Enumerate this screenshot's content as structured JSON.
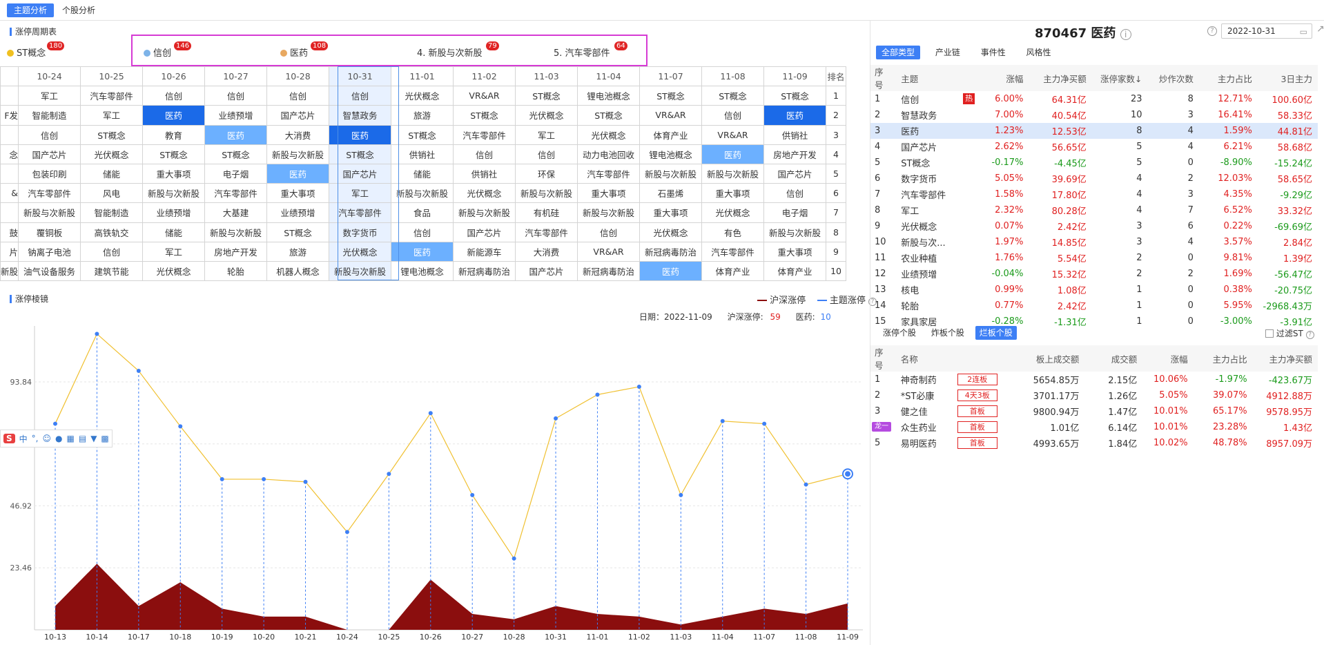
{
  "top_tabs": [
    {
      "label": "主题分析"
    },
    {
      "label": "个股分析"
    }
  ],
  "cycle_title": "涨停周期表",
  "themes": [
    {
      "label": "ST概念",
      "badge": "180",
      "color": "#f0c020"
    },
    {
      "label": "信创",
      "badge": "146",
      "color": "#7db3e8"
    },
    {
      "label": "医药",
      "badge": "108",
      "color": "#e8a860"
    },
    {
      "label": "4. 新股与次新股",
      "badge": "79",
      "color": ""
    },
    {
      "label": "5. 汽车零部件",
      "badge": "64",
      "color": ""
    }
  ],
  "grid": {
    "dates": [
      "",
      "10-24",
      "10-25",
      "10-26",
      "10-27",
      "10-28",
      "10-31",
      "11-01",
      "11-02",
      "11-03",
      "11-04",
      "11-07",
      "11-08",
      "11-09",
      "排名"
    ],
    "rows": [
      {
        "cells": [
          "",
          "军工",
          "汽车零部件",
          "信创",
          "信创",
          "信创",
          "信创",
          "光伏概念",
          "VR&AR",
          "ST概念",
          "锂电池概念",
          "ST概念",
          "ST概念",
          "ST概念"
        ],
        "rank": "1"
      },
      {
        "cells": [
          "F发",
          "智能制造",
          "军工",
          "医药",
          "业绩预增",
          "国产芯片",
          "智慧政务",
          "旅游",
          "ST概念",
          "光伏概念",
          "ST概念",
          "VR&AR",
          "信创",
          "医药"
        ],
        "rank": "2"
      },
      {
        "cells": [
          "",
          "信创",
          "ST概念",
          "教育",
          "医药",
          "大消费",
          "医药",
          "ST概念",
          "汽车零部件",
          "军工",
          "光伏概念",
          "体育产业",
          "VR&AR",
          "供销社"
        ],
        "rank": "3"
      },
      {
        "cells": [
          "念",
          "国产芯片",
          "光伏概念",
          "ST概念",
          "ST概念",
          "新股与次新股",
          "ST概念",
          "供销社",
          "信创",
          "信创",
          "动力电池回收",
          "锂电池概念",
          "医药",
          "房地产开发"
        ],
        "rank": "4"
      },
      {
        "cells": [
          "",
          "包装印刷",
          "储能",
          "重大事项",
          "电子烟",
          "医药",
          "国产芯片",
          "储能",
          "供销社",
          "环保",
          "汽车零部件",
          "新股与次新股",
          "新股与次新股",
          "国产芯片"
        ],
        "rank": "5"
      },
      {
        "cells": [
          "&",
          "汽车零部件",
          "风电",
          "新股与次新股",
          "汽车零部件",
          "重大事项",
          "军工",
          "新股与次新股",
          "光伏概念",
          "新股与次新股",
          "重大事项",
          "石墨烯",
          "重大事项",
          "信创"
        ],
        "rank": "6"
      },
      {
        "cells": [
          "",
          "新股与次新股",
          "智能制造",
          "业绩预增",
          "大基建",
          "业绩预增",
          "汽车零部件",
          "食品",
          "新股与次新股",
          "有机硅",
          "新股与次新股",
          "重大事项",
          "光伏概念",
          "电子烟"
        ],
        "rank": "7"
      },
      {
        "cells": [
          "鼓",
          "覆铜板",
          "高铁轨交",
          "储能",
          "新股与次新股",
          "ST概念",
          "数字货币",
          "信创",
          "国产芯片",
          "汽车零部件",
          "信创",
          "光伏概念",
          "有色",
          "新股与次新股"
        ],
        "rank": "8"
      },
      {
        "cells": [
          "片",
          "钠离子电池",
          "信创",
          "军工",
          "房地产开发",
          "旅游",
          "光伏概念",
          "医药",
          "新能源车",
          "大消费",
          "VR&AR",
          "新冠病毒防治",
          "汽车零部件",
          "重大事项"
        ],
        "rank": "9"
      },
      {
        "cells": [
          "新股",
          "油气设备服务",
          "建筑节能",
          "光伏概念",
          "轮胎",
          "机器人概念",
          "新股与次新股",
          "锂电池概念",
          "新冠病毒防治",
          "国产芯片",
          "新冠病毒防治",
          "医药",
          "体育产业",
          "体育产业"
        ],
        "rank": "10"
      }
    ]
  },
  "mirror": {
    "title": "涨停棱镜",
    "legend_a": "沪深涨停",
    "legend_b": "主题涨停",
    "info_date_label": "日期：2022-11-09",
    "info_a_label": "沪深涨停:",
    "info_a_value": "59",
    "info_b_label": "医药:",
    "info_b_value": "10"
  },
  "chart_data": {
    "type": "line",
    "x": [
      "10-13",
      "10-14",
      "10-17",
      "10-18",
      "10-19",
      "10-20",
      "10-21",
      "10-24",
      "10-25",
      "10-26",
      "10-27",
      "10-28",
      "10-31",
      "11-01",
      "11-02",
      "11-03",
      "11-04",
      "11-07",
      "11-08",
      "11-09"
    ],
    "y_ticks": [
      "23.46",
      "46.92",
      "70.38",
      "93.84"
    ],
    "series": [
      {
        "name": "沪深涨停",
        "type": "area",
        "color": "#8b0e0e",
        "values": [
          9,
          25,
          9,
          18,
          8,
          5,
          5,
          0,
          0,
          19,
          6,
          4,
          9,
          6,
          5,
          2,
          5,
          8,
          6,
          10
        ]
      },
      {
        "name": "主题涨停",
        "type": "line",
        "color": "#f0c030",
        "values": [
          78,
          112,
          98,
          77,
          57,
          57,
          56,
          37,
          59,
          82,
          51,
          27,
          80,
          89,
          92,
          51,
          79,
          78,
          55,
          59
        ]
      }
    ],
    "ylim": [
      0,
      115
    ]
  },
  "right_header": {
    "code_name": "870467 医药",
    "date": "2022-10-31"
  },
  "cat_tabs": [
    "全部类型",
    "产业链",
    "事件性",
    "风格性"
  ],
  "theme_table": {
    "headers": [
      "序号",
      "主题",
      "涨幅",
      "主力净买额",
      "涨停家数↓",
      "炒作次数",
      "主力占比",
      "3日主力"
    ],
    "rows": [
      [
        "1",
        "信创",
        "6.00%",
        "64.31亿",
        "23",
        "8",
        "12.71%",
        "100.60亿"
      ],
      [
        "2",
        "智慧政务",
        "7.00%",
        "40.54亿",
        "10",
        "3",
        "16.41%",
        "58.33亿"
      ],
      [
        "3",
        "医药",
        "1.23%",
        "12.53亿",
        "8",
        "4",
        "1.59%",
        "44.81亿"
      ],
      [
        "4",
        "国产芯片",
        "2.62%",
        "56.65亿",
        "5",
        "4",
        "6.21%",
        "58.68亿"
      ],
      [
        "5",
        "ST概念",
        "-0.17%",
        "-4.45亿",
        "5",
        "0",
        "-8.90%",
        "-15.24亿"
      ],
      [
        "6",
        "数字货币",
        "5.05%",
        "39.69亿",
        "4",
        "2",
        "12.03%",
        "58.65亿"
      ],
      [
        "7",
        "汽车零部件",
        "1.58%",
        "17.80亿",
        "4",
        "3",
        "4.35%",
        "-9.29亿"
      ],
      [
        "8",
        "军工",
        "2.32%",
        "80.28亿",
        "4",
        "7",
        "6.52%",
        "33.32亿"
      ],
      [
        "9",
        "光伏概念",
        "0.07%",
        "2.42亿",
        "3",
        "6",
        "0.22%",
        "-69.69亿"
      ],
      [
        "10",
        "新股与次...",
        "1.97%",
        "14.85亿",
        "3",
        "4",
        "3.57%",
        "2.84亿"
      ],
      [
        "11",
        "农业种植",
        "1.76%",
        "5.54亿",
        "2",
        "0",
        "9.81%",
        "1.39亿"
      ],
      [
        "12",
        "业绩预增",
        "-0.04%",
        "15.32亿",
        "2",
        "2",
        "1.69%",
        "-56.47亿"
      ],
      [
        "13",
        "核电",
        "0.99%",
        "1.08亿",
        "1",
        "0",
        "0.38%",
        "-20.75亿"
      ],
      [
        "14",
        "轮胎",
        "0.77%",
        "2.42亿",
        "1",
        "0",
        "5.95%",
        "-2968.43万"
      ],
      [
        "15",
        "家具家居",
        "-0.28%",
        "-1.31亿",
        "1",
        "0",
        "-3.00%",
        "-3.91亿"
      ]
    ],
    "hot_label": "热"
  },
  "sub_tabs": [
    "涨停个股",
    "炸板个股",
    "烂板个股"
  ],
  "filter_st_label": "过滤ST",
  "stock_table": {
    "headers": [
      "序号",
      "名称",
      "板上成交额",
      "成交额",
      "涨幅",
      "主力占比",
      "主力净买额"
    ],
    "rows": [
      [
        "1",
        "神奇制药",
        "2连板",
        "5654.85万",
        "2.15亿",
        "10.06%",
        "-1.97%",
        "-423.67万"
      ],
      [
        "2",
        "*ST必康",
        "4天3板",
        "3701.17万",
        "1.26亿",
        "5.05%",
        "39.07%",
        "4912.88万"
      ],
      [
        "3",
        "健之佳",
        "首板",
        "9800.94万",
        "1.47亿",
        "10.01%",
        "65.17%",
        "9578.95万"
      ],
      [
        "4",
        "众生药业",
        "首板",
        "1.01亿",
        "6.14亿",
        "10.01%",
        "23.28%",
        "1.43亿"
      ],
      [
        "5",
        "易明医药",
        "首板",
        "4993.65万",
        "1.84亿",
        "10.02%",
        "48.78%",
        "8957.09万"
      ]
    ],
    "dragon_label": "龙一"
  },
  "ime": {
    "label": "中"
  }
}
